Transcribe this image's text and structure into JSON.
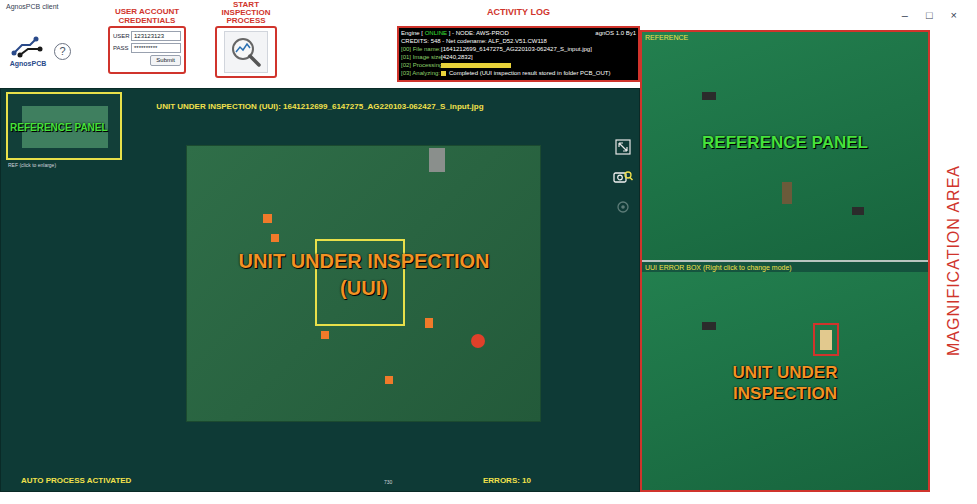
{
  "window": {
    "title": "AgnosPCB client",
    "controls": [
      "–",
      "□",
      "×"
    ]
  },
  "header": {
    "logo": "AgnosPCB",
    "help": "?",
    "credentials": {
      "annotation": "USER ACCOUNT CREDENTIALS",
      "user_label": "USER",
      "user_value": "123123123",
      "pass_label": "PASS",
      "pass_value": "**********",
      "submit": "Submit"
    },
    "start": {
      "annotation": "START INSPECTION PROCESS"
    },
    "log": {
      "annotation": "ACTIVITY LOG",
      "engine": "Engine [",
      "engine_state": "ONLINE",
      "node": "] - NODE: AWS-PROD",
      "version": "agnOS 1.0 By1",
      "credits": "CREDITS: 548 - Net codename: ALF_D52.V51.CW118",
      "entries": [
        {
          "kind": "text",
          "step": "[00] File name:",
          "value": "[1641212699_6147275_AG220103-062427_S_input.jpg]"
        },
        {
          "kind": "text",
          "step": "[01] Image size:",
          "value": "[4240,2832]"
        },
        {
          "kind": "bar",
          "step": "[02] Processing:",
          "level": 1
        },
        {
          "kind": "done",
          "step": "[03] Analyzing:",
          "value": "Completed (UUI inspection result stored in folder PCB_OUT)"
        }
      ]
    }
  },
  "inspection": {
    "title": "UNIT UNDER INSPECTION (UUI): 1641212699_6147275_AG220103-062427_S_input.jpg",
    "reference_label": "REFERENCE PANEL",
    "reference_caption": "REF (click to enlarge)",
    "uui_label": "UNIT UNDER INSPECTION (UUI)",
    "status": "AUTO PROCESS ACTIVATED",
    "ruler": "730",
    "errors": "ERRORS: 10"
  },
  "magnification": {
    "annotation": "MAGNIFICATION AREA",
    "reference_title": "REFERENCE",
    "reference_label": "REFERENCE PANEL",
    "uui_title": "UUI ERROR BOX (Right click to change mode)",
    "uui_label": "UNIT UNDER INSPECTION"
  }
}
